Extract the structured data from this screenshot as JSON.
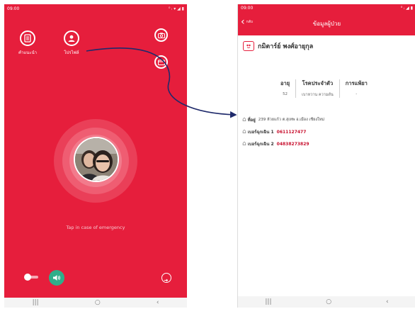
{
  "left_screen": {
    "status_time": "09:00",
    "status_right": "⁰ ᵢ ▾ ◢ ▮",
    "menu": {
      "instructions_label": "คำแนะนำ",
      "profile_label": "โปรไฟล์"
    },
    "emergency_text": "Tap in case of emergency",
    "nav": {
      "recents": "|||",
      "home": "○",
      "back": "‹"
    }
  },
  "right_screen": {
    "status_time": "09:00",
    "status_right": "⁰ ᵢ ◢ ▮",
    "header": {
      "back_label": "กลับ",
      "title": "ข้อมูลผู้ป่วย"
    },
    "patient_name": "กมิตาร์ย์ พงศ์อายุกุล",
    "info": {
      "age_label": "อายุ",
      "age_value": "52",
      "condition_label": "โรคประจำตัว",
      "condition_value": "เบาหวาน ความดัน",
      "allergy_label": "การแพ้ยา",
      "allergy_value": "-"
    },
    "address_label": "ที่อยู่",
    "address_value": "239 ห้วยแก้ว ต.สุเทพ อ.เมือง เชียงใหม่",
    "emergency1_label": "เบอร์ฉุกเฉิน 1",
    "emergency1_value": "0611127477",
    "emergency2_label": "เบอร์ฉุกเฉิน 2",
    "emergency2_value": "0483827382​9",
    "nav": {
      "recents": "|||",
      "home": "○",
      "back": "‹"
    }
  },
  "colors": {
    "brand_red": "#e61e3c",
    "sound_green": "#2fae8a",
    "arrow_navy": "#1f2a6b"
  }
}
